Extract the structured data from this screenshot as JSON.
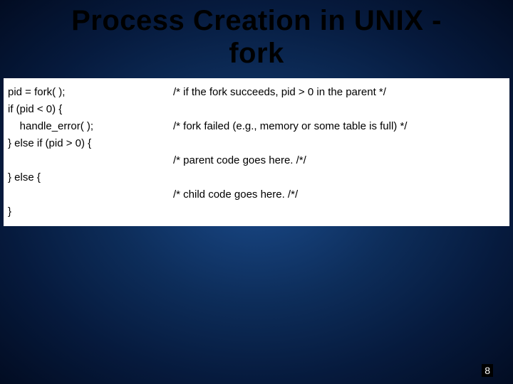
{
  "title_line1": "Process Creation in UNIX -",
  "title_line2": "fork",
  "code": {
    "rows": [
      {
        "left": "pid = fork( );",
        "right": "/* if the fork succeeds, pid > 0 in the parent */"
      },
      {
        "left": "if (pid < 0) {",
        "right": ""
      },
      {
        "left": "    handle_error( );",
        "right": "/* fork failed (e.g., memory or some table is full) */"
      },
      {
        "left": "} else if (pid > 0) {",
        "right": ""
      },
      {
        "left": "",
        "right": "/* parent code goes here. /*/"
      },
      {
        "left": "} else {",
        "right": ""
      },
      {
        "left": "",
        "right": "/* child code goes here. /*/"
      },
      {
        "left": "}",
        "right": ""
      }
    ]
  },
  "page_number": "8"
}
